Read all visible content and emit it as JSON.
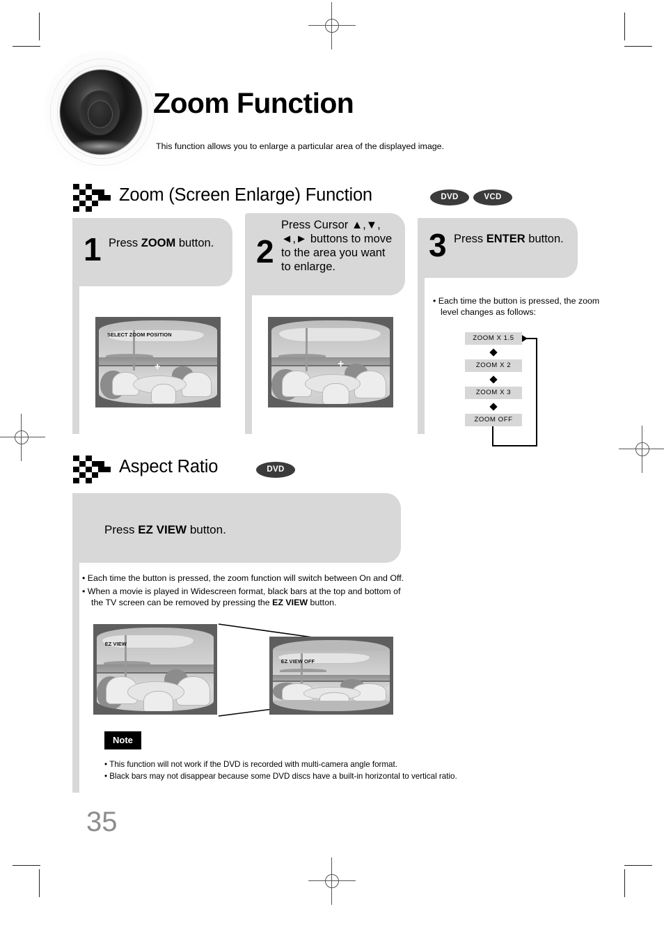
{
  "header": {
    "title": "Zoom Function",
    "subtitle": "This function allows you to enlarge a particular area of the displayed image.",
    "disc_icon": "dvd-disc-icon"
  },
  "sections": [
    {
      "title": "Zoom (Screen Enlarge) Function",
      "badges": [
        "DVD",
        "VCD"
      ]
    },
    {
      "title": "Aspect Ratio",
      "badges": [
        "DVD"
      ]
    }
  ],
  "steps": [
    {
      "number": "1",
      "text_before": "Press ",
      "text_bold": "ZOOM",
      "text_after": " button."
    },
    {
      "number": "2",
      "text_before": "Press Cursor ▲,▼, ◄,► buttons to move to the area you want to enlarge.",
      "text_bold": "",
      "text_after": ""
    },
    {
      "number": "3",
      "text_before": "Press ",
      "text_bold": "ENTER",
      "text_after": " button."
    }
  ],
  "screens": {
    "step1_osd": "SELECT ZOOM POSITION",
    "step2_osd": "",
    "ez_view_on_osd": "EZ VIEW",
    "ez_view_off_osd": "EZ VIEW OFF",
    "cursor_glyph": "+"
  },
  "flow": {
    "note": "Each time the button is pressed, the zoom level changes as follows:",
    "items": [
      "ZOOM  X 1.5",
      "ZOOM  X 2",
      "ZOOM  X 3",
      "ZOOM  OFF"
    ]
  },
  "aspect": {
    "press_before": "Press ",
    "press_bold": "EZ VIEW",
    "press_after": " button.",
    "bullet1": "Each time the button is pressed, the zoom function will switch between On and Off.",
    "bullet2a": "When a movie is played in Widescreen format, black bars at the top and bottom of the TV screen can be removed by pressing the ",
    "bullet2b": "EZ VIEW",
    "bullet2c": " button."
  },
  "note": {
    "label": "Note",
    "items": [
      "This function will not work if the DVD is recorded with multi-camera angle format.",
      "Black bars may not disappear because some DVD discs have a built-in horizontal to vertical ratio."
    ]
  },
  "footer": {
    "page_number": "35"
  },
  "colors": {
    "box_gray": "#d8d8d8",
    "badge_dark": "#3b3b3b",
    "page_number_gray": "#8d8d8d",
    "tv_bezel": "#5e5e5e"
  }
}
